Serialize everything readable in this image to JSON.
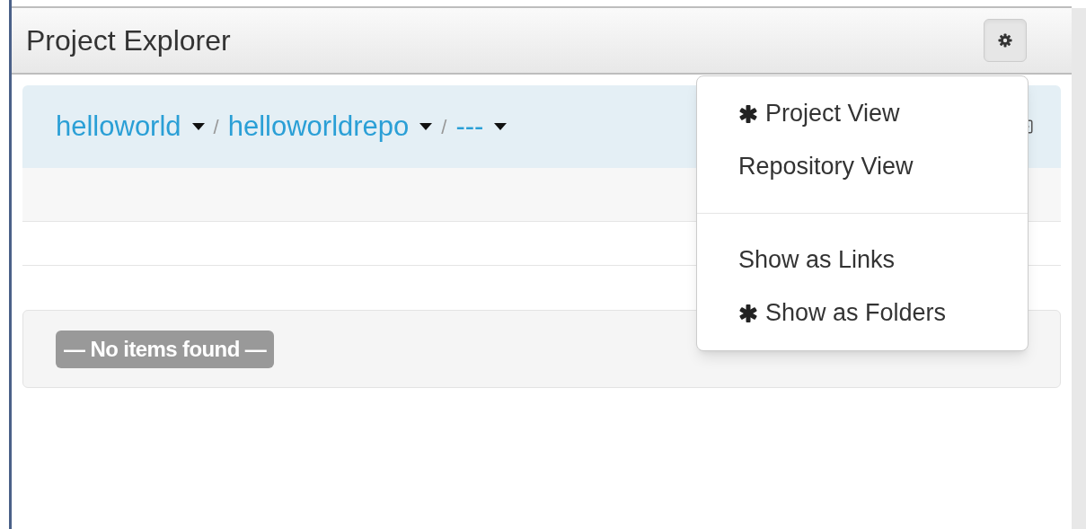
{
  "panel": {
    "title": "Project Explorer"
  },
  "breadcrumbs": [
    {
      "label": "helloworld"
    },
    {
      "label": "helloworldrepo"
    },
    {
      "label": "---"
    }
  ],
  "breadcrumb_separator": "/",
  "empty_message": "— No items found —",
  "menu": {
    "open": true,
    "groups": [
      [
        {
          "label": "Project View",
          "selected": true
        },
        {
          "label": "Repository View",
          "selected": false
        }
      ],
      [
        {
          "label": "Show as Links",
          "selected": false
        },
        {
          "label": "Show as Folders",
          "selected": true
        }
      ]
    ]
  }
}
